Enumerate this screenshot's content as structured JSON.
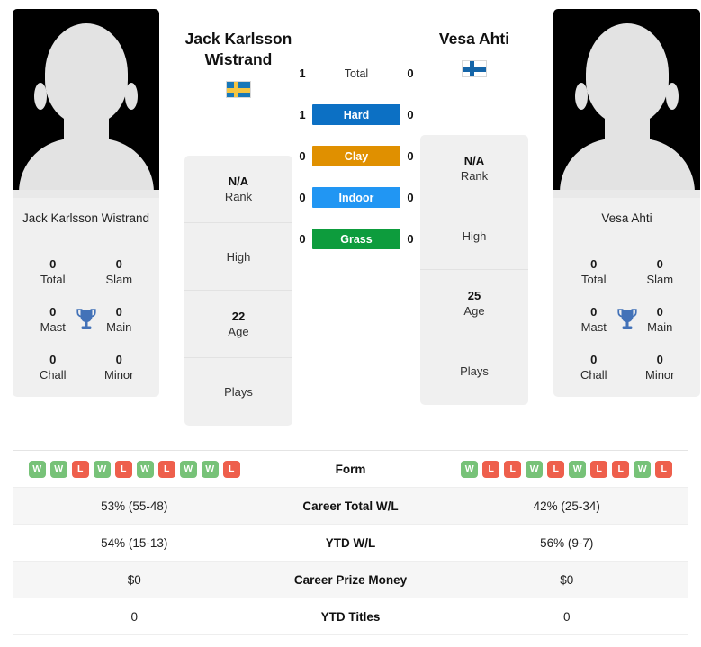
{
  "players": {
    "left": {
      "display_name_line1": "Jack Karlsson",
      "display_name_line2": "Wistrand",
      "card_name": "Jack Karlsson Wistrand",
      "flag": "sweden-flag",
      "avatar": "player-avatar-placeholder",
      "titles": [
        {
          "value": "0",
          "label": "Total"
        },
        {
          "value": "0",
          "label": "Slam"
        },
        {
          "value": "0",
          "label": "Mast"
        },
        {
          "value": "0",
          "label": "Main"
        },
        {
          "value": "0",
          "label": "Chall"
        },
        {
          "value": "0",
          "label": "Minor"
        }
      ],
      "info": [
        {
          "value": "N/A",
          "label": "Rank"
        },
        {
          "value": "",
          "label": "High"
        },
        {
          "value": "22",
          "label": "Age"
        },
        {
          "value": "",
          "label": "Plays"
        }
      ]
    },
    "right": {
      "display_name_line1": "Vesa Ahti",
      "display_name_line2": "",
      "card_name": "Vesa Ahti",
      "flag": "finland-flag",
      "avatar": "player-avatar-placeholder",
      "titles": [
        {
          "value": "0",
          "label": "Total"
        },
        {
          "value": "0",
          "label": "Slam"
        },
        {
          "value": "0",
          "label": "Mast"
        },
        {
          "value": "0",
          "label": "Main"
        },
        {
          "value": "0",
          "label": "Chall"
        },
        {
          "value": "0",
          "label": "Minor"
        }
      ],
      "info": [
        {
          "value": "N/A",
          "label": "Rank"
        },
        {
          "value": "",
          "label": "High"
        },
        {
          "value": "25",
          "label": "Age"
        },
        {
          "value": "",
          "label": "Plays"
        }
      ]
    }
  },
  "head_to_head": {
    "rows": [
      {
        "label": "Total",
        "left": "1",
        "right": "0",
        "color": "transparent",
        "styled": false
      },
      {
        "label": "Hard",
        "left": "1",
        "right": "0",
        "color": "#0c70c4",
        "styled": true
      },
      {
        "label": "Clay",
        "left": "0",
        "right": "0",
        "color": "#e09000",
        "styled": true
      },
      {
        "label": "Indoor",
        "left": "0",
        "right": "0",
        "color": "#2196f3",
        "styled": true
      },
      {
        "label": "Grass",
        "left": "0",
        "right": "0",
        "color": "#0d9c3d",
        "styled": true
      }
    ]
  },
  "stats": {
    "rows": [
      {
        "label": "Form",
        "type": "form",
        "left_form": [
          "W",
          "W",
          "L",
          "W",
          "L",
          "W",
          "L",
          "W",
          "W",
          "L"
        ],
        "right_form": [
          "W",
          "L",
          "L",
          "W",
          "L",
          "W",
          "L",
          "L",
          "W",
          "L"
        ],
        "shaded": false
      },
      {
        "label": "Career Total W/L",
        "type": "text",
        "left": "53% (55-48)",
        "right": "42% (25-34)",
        "shaded": true
      },
      {
        "label": "YTD W/L",
        "type": "text",
        "left": "54% (15-13)",
        "right": "56% (9-7)",
        "shaded": false
      },
      {
        "label": "Career Prize Money",
        "type": "text",
        "left": "$0",
        "right": "$0",
        "shaded": true
      },
      {
        "label": "YTD Titles",
        "type": "text",
        "left": "0",
        "right": "0",
        "shaded": false
      }
    ]
  },
  "colors": {
    "win": "#77c278",
    "loss": "#ee5f4c",
    "hard": "#0c70c4",
    "clay": "#e09000",
    "indoor": "#2196f3",
    "grass": "#0d9c3d",
    "trophy": "#4372b8"
  }
}
